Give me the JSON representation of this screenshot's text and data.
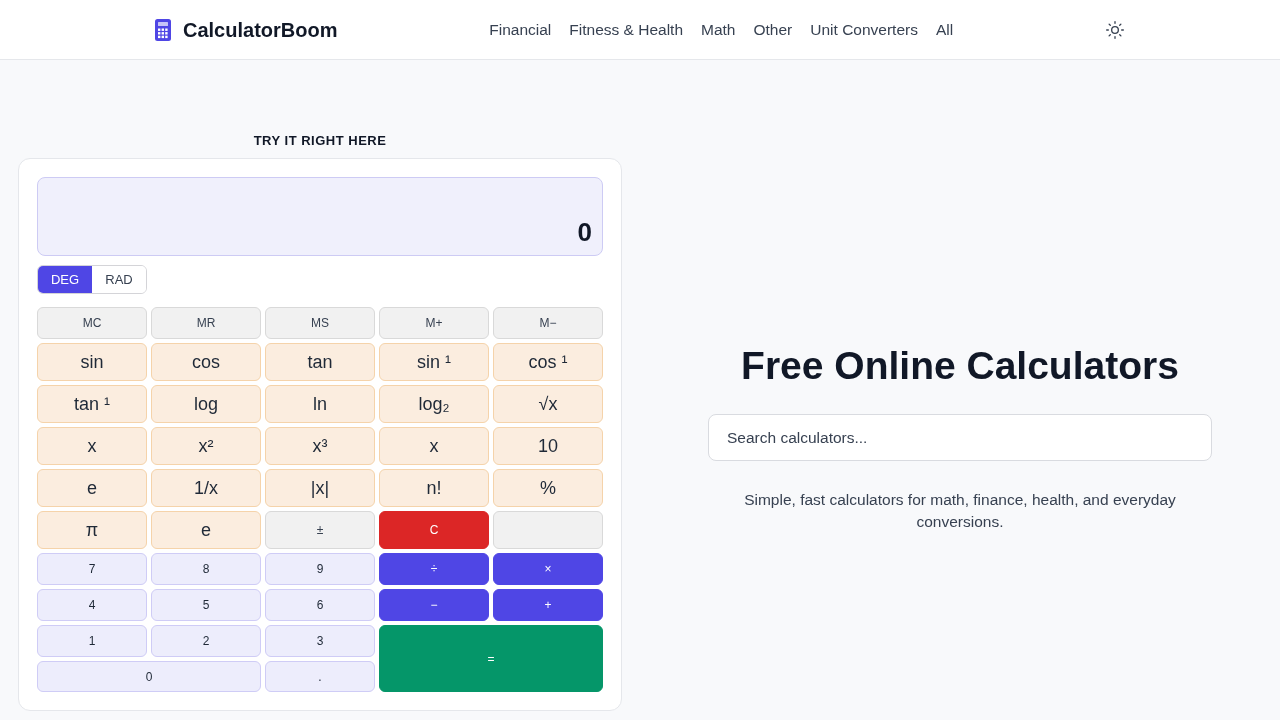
{
  "header": {
    "logo": "CalculatorBoom",
    "nav": [
      "Financial",
      "Fitness & Health",
      "Math",
      "Other",
      "Unit Converters",
      "All"
    ]
  },
  "calculator": {
    "heading": "TRY IT RIGHT HERE",
    "display": "0",
    "angle_modes": [
      {
        "label": "DEG",
        "selected": true
      },
      {
        "label": "RAD",
        "selected": false
      }
    ],
    "keys": [
      {
        "label": "MC",
        "kind": "memory"
      },
      {
        "label": "MR",
        "kind": "memory"
      },
      {
        "label": "MS",
        "kind": "memory"
      },
      {
        "label": "M+",
        "kind": "memory"
      },
      {
        "label": "M−",
        "kind": "memory"
      },
      {
        "label": "sin",
        "kind": "function"
      },
      {
        "label": "cos",
        "kind": "function"
      },
      {
        "label": "tan",
        "kind": "function"
      },
      {
        "label": "sin ¹",
        "kind": "function"
      },
      {
        "label": "cos ¹",
        "kind": "function"
      },
      {
        "label": "tan ¹",
        "kind": "function"
      },
      {
        "label": "log",
        "kind": "function"
      },
      {
        "label": "ln",
        "kind": "function"
      },
      {
        "label": "log₂",
        "kind": "function"
      },
      {
        "label": "√x",
        "kind": "function"
      },
      {
        "label": "x",
        "kind": "function"
      },
      {
        "label": "x²",
        "kind": "function"
      },
      {
        "label": "x³",
        "kind": "function"
      },
      {
        "label": "x",
        "kind": "function"
      },
      {
        "label": "10",
        "kind": "function"
      },
      {
        "label": "e",
        "kind": "function"
      },
      {
        "label": "1/x",
        "kind": "function"
      },
      {
        "label": "|x|",
        "kind": "function"
      },
      {
        "label": "n!",
        "kind": "function"
      },
      {
        "label": "%",
        "kind": "function"
      },
      {
        "label": "π",
        "kind": "function"
      },
      {
        "label": "e",
        "kind": "function"
      },
      {
        "label": "±",
        "kind": "neutral"
      },
      {
        "label": "C",
        "kind": "clear"
      },
      {
        "kind": "neutral"
      },
      {
        "label": "7",
        "kind": "digit"
      },
      {
        "label": "8",
        "kind": "digit"
      },
      {
        "label": "9",
        "kind": "digit"
      },
      {
        "label": "÷",
        "kind": "operator"
      },
      {
        "label": "×",
        "kind": "operator"
      },
      {
        "label": "4",
        "kind": "digit"
      },
      {
        "label": "5",
        "kind": "digit"
      },
      {
        "label": "6",
        "kind": "digit"
      },
      {
        "label": "−",
        "kind": "operator"
      },
      {
        "label": "+",
        "kind": "operator"
      },
      {
        "label": "1",
        "kind": "digit"
      },
      {
        "label": "2",
        "kind": "digit"
      },
      {
        "label": "3",
        "kind": "digit"
      },
      {
        "label": "=",
        "kind": "equals"
      },
      {
        "label": "0",
        "kind": "wide"
      },
      {
        "label": ".",
        "kind": "digit"
      }
    ]
  },
  "hero": {
    "title": "Free Online Calculators",
    "search": {
      "placeholder": "Search calculators..."
    },
    "description": "Simple, fast calculators for math, finance, health, and everyday conversions."
  }
}
